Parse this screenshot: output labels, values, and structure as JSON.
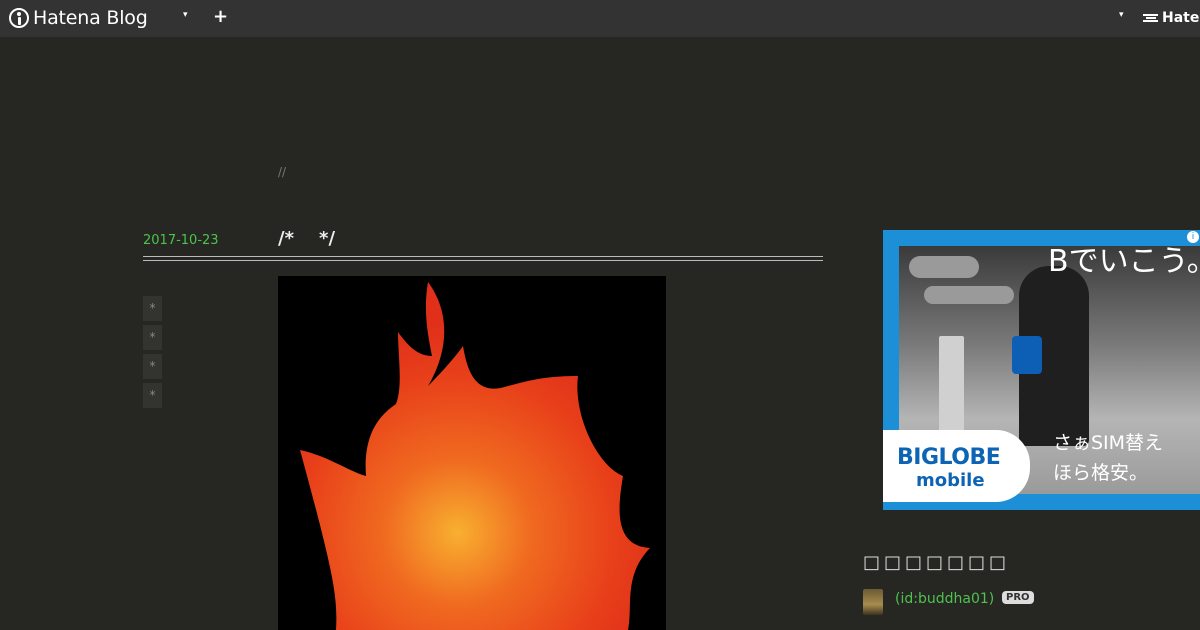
{
  "topbar": {
    "logo_text": "Hatena Blog",
    "dropdown_glyph": "▾",
    "add_glyph": "+",
    "right_logo_text": "Hatena"
  },
  "entry": {
    "separator": "//",
    "date": "2017-10-23",
    "title": "/*    */",
    "share_buttons": [
      "*",
      "*",
      "*",
      "*"
    ],
    "image": "flame-illustration"
  },
  "ad": {
    "headline": "Bでいこう。",
    "subtext_line1": "さぁSIM替え",
    "subtext_line2": "ほら格安。",
    "brand_line1": "BIGLOBE",
    "brand_line2": "mobile",
    "info_glyph": "i",
    "colors": {
      "frame": "#1c8fd6",
      "brand": "#0e64b4"
    }
  },
  "profile": {
    "heading": "□□□□□□□",
    "user_id": "(id:buddha01)",
    "badge": "PRO"
  },
  "colors": {
    "background": "#262622",
    "topbar": "#333333",
    "date_link": "#4ec24e"
  }
}
